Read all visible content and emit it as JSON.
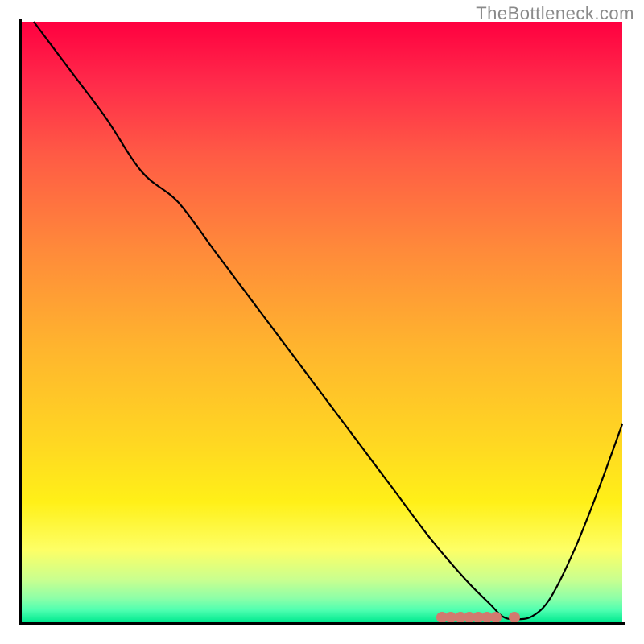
{
  "attribution": "TheBottleneck.com",
  "colors": {
    "curve": "#000000",
    "marker": "#d17a6f",
    "gradient_top": "#ff0040",
    "gradient_bottom": "#00e98f"
  },
  "chart_data": {
    "type": "line",
    "title": "",
    "xlabel": "",
    "ylabel": "",
    "xlim": [
      0,
      100
    ],
    "ylim": [
      0,
      100
    ],
    "series": [
      {
        "name": "curve",
        "x": [
          2,
          8,
          14,
          20,
          26,
          32,
          38,
          44,
          50,
          56,
          62,
          68,
          74,
          78,
          80,
          82,
          85,
          88,
          92,
          96,
          100
        ],
        "y": [
          100,
          92,
          84,
          75,
          70,
          62,
          54,
          46,
          38,
          30,
          22,
          14,
          7,
          3,
          1,
          0.5,
          1,
          4,
          12,
          22,
          33
        ]
      }
    ],
    "markers": {
      "name": "highlight",
      "x": [
        70,
        71.5,
        73,
        74.5,
        76,
        77.5,
        79,
        82
      ],
      "y": [
        0.8,
        0.8,
        0.8,
        0.8,
        0.8,
        0.8,
        0.8,
        0.8
      ]
    }
  }
}
